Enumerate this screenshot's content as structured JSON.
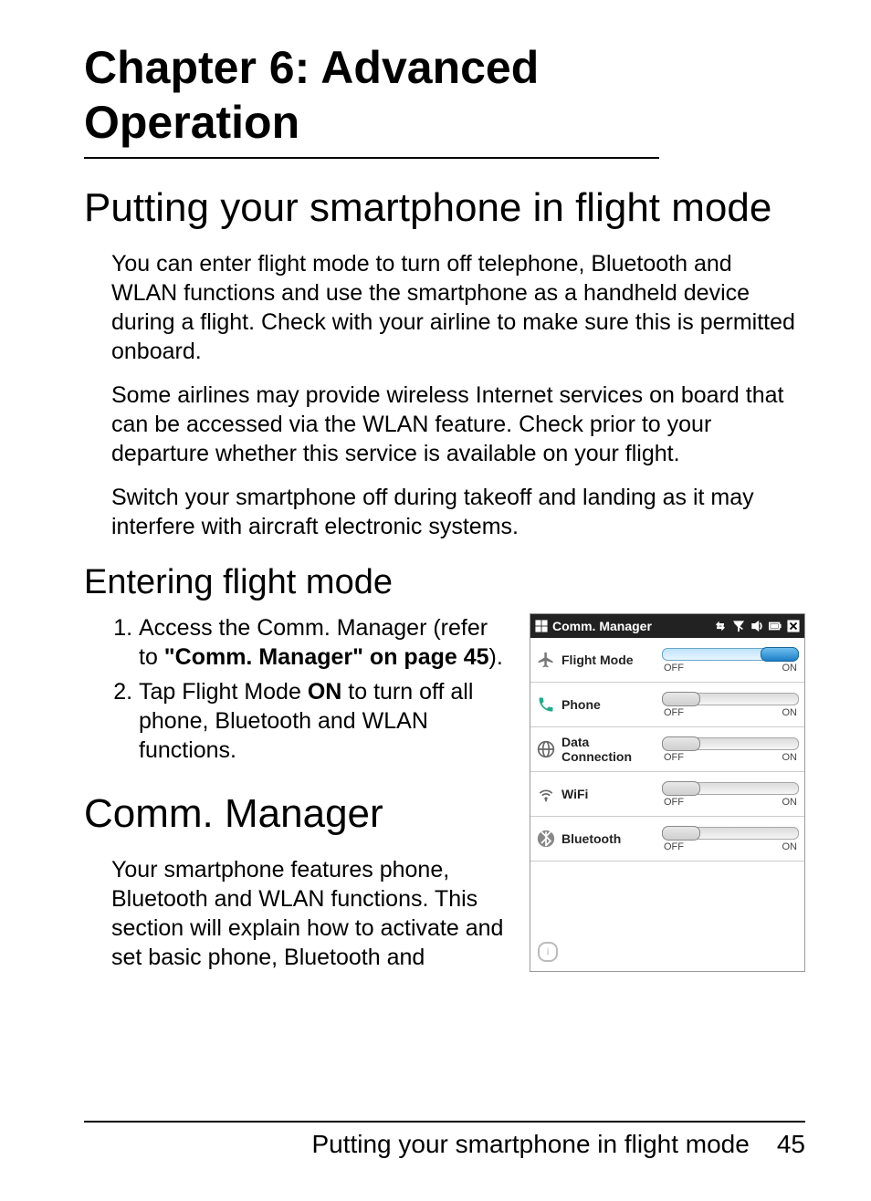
{
  "chapter_title": "Chapter 6: Advanced Operation",
  "section_flight": "Putting your smartphone in flight mode",
  "para1": "You can enter flight mode to turn off telephone, Bluetooth and WLAN functions and use the smartphone as a handheld device during a flight. Check with your airline to make sure this is permitted onboard.",
  "para2": "Some airlines may provide wireless Internet services on board that can be accessed via the WLAN feature. Check prior to your departure whether this service is available on your flight.",
  "para3": "Switch your smartphone off during takeoff and landing as it may interfere with aircraft electronic systems.",
  "sub_enter": "Entering flight mode",
  "step1_a": "Access the Comm. Manager (refer to ",
  "step1_b": "\"Comm. Manager\" on page 45",
  "step1_c": ").",
  "step2_a": "Tap Flight Mode ",
  "step2_on": "ON",
  "step2_b": " to turn off all phone, Bluetooth and WLAN functions.",
  "section_comm": "Comm. Manager",
  "comm_para": "Your smartphone features phone, Bluetooth and WLAN functions. This section will explain how to activate and set basic phone, Bluetooth and",
  "comm_shot": {
    "title": "Comm. Manager",
    "off": "OFF",
    "on": "ON",
    "rows": [
      {
        "label": "Flight Mode",
        "state": "on"
      },
      {
        "label": "Phone",
        "state": "off"
      },
      {
        "label": "Data Connection",
        "state": "off"
      },
      {
        "label": "WiFi",
        "state": "off"
      },
      {
        "label": "Bluetooth",
        "state": "off"
      }
    ]
  },
  "footer_text": "Putting your smartphone in flight mode",
  "page_num": "45"
}
